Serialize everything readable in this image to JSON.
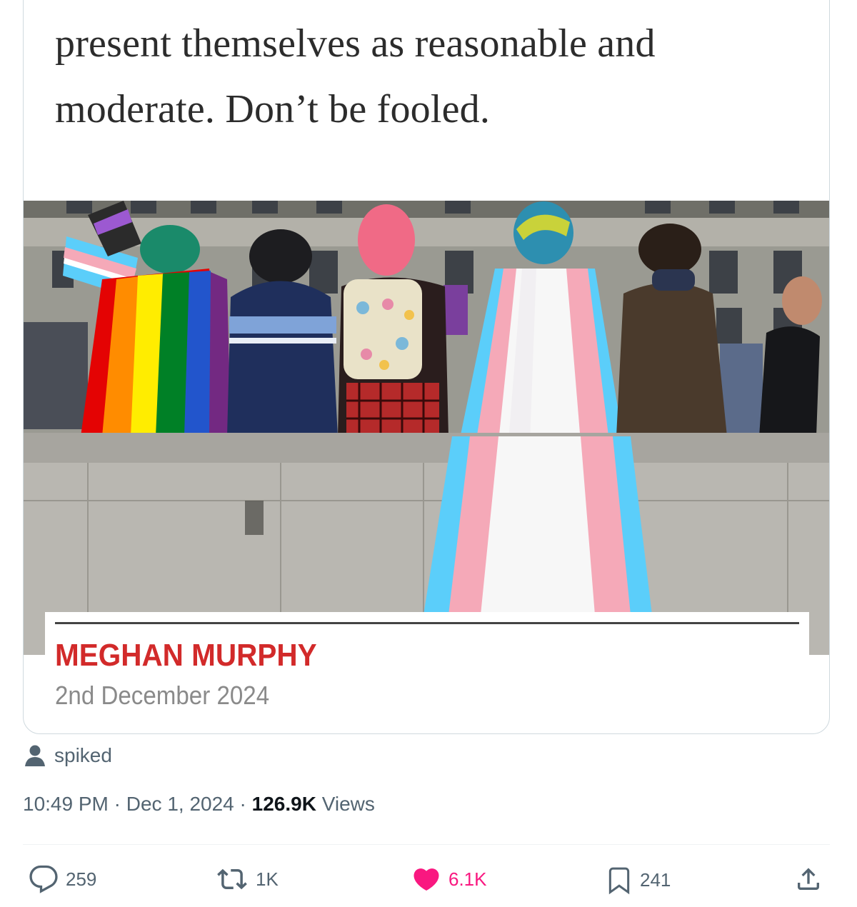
{
  "card": {
    "headline_lines": [
      "present themselves as reasonable and",
      "moderate. Don’t be fooled."
    ],
    "author": "MEGHAN MURPHY",
    "date": "2nd December 2024"
  },
  "source": {
    "icon": "person-icon",
    "name": "spiked"
  },
  "meta": {
    "time": "10:49 PM",
    "separator": "·",
    "date": "Dec 1, 2024",
    "views_count": "126.9K",
    "views_label": "Views"
  },
  "actions": {
    "reply": {
      "icon": "reply-icon",
      "count": "259"
    },
    "repost": {
      "icon": "repost-icon",
      "count": "1K"
    },
    "like": {
      "icon": "heart-icon",
      "count": "6.1K",
      "color": "#f91880"
    },
    "bookmark": {
      "icon": "bookmark-icon",
      "count": "241"
    },
    "share": {
      "icon": "share-icon"
    }
  },
  "colors": {
    "author_red": "#d22a2a",
    "muted": "#536471",
    "border": "#cfd9de"
  }
}
